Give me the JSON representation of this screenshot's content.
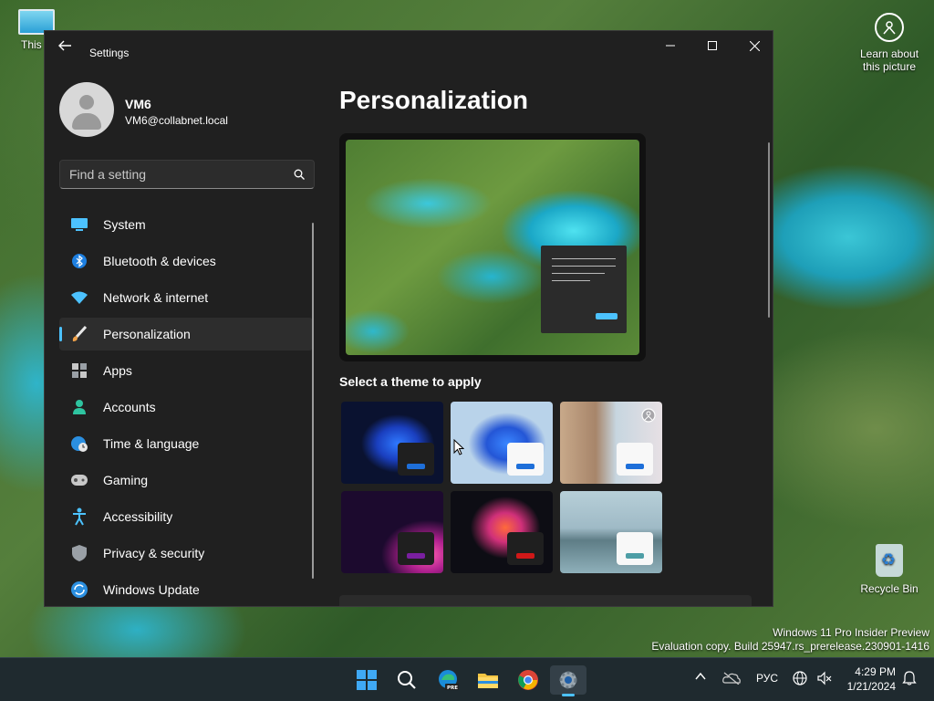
{
  "desktop": {
    "this_pc_label": "This P",
    "learn_label": "Learn about this picture",
    "recycle_label": "Recycle Bin",
    "watermark_line1": "Windows 11 Pro Insider Preview",
    "watermark_line2": "Evaluation copy. Build 25947.rs_prerelease.230901-1416"
  },
  "window": {
    "title": "Settings"
  },
  "user": {
    "name": "VM6",
    "email": "VM6@collabnet.local"
  },
  "search": {
    "placeholder": "Find a setting"
  },
  "sidebar": {
    "items": [
      {
        "label": "System",
        "icon": "monitor-icon",
        "active": false
      },
      {
        "label": "Bluetooth & devices",
        "icon": "bluetooth-icon",
        "active": false
      },
      {
        "label": "Network & internet",
        "icon": "wifi-icon",
        "active": false
      },
      {
        "label": "Personalization",
        "icon": "paintbrush-icon",
        "active": true
      },
      {
        "label": "Apps",
        "icon": "apps-icon",
        "active": false
      },
      {
        "label": "Accounts",
        "icon": "person-icon",
        "active": false
      },
      {
        "label": "Time & language",
        "icon": "globe-clock-icon",
        "active": false
      },
      {
        "label": "Gaming",
        "icon": "gamepad-icon",
        "active": false
      },
      {
        "label": "Accessibility",
        "icon": "accessibility-icon",
        "active": false
      },
      {
        "label": "Privacy & security",
        "icon": "shield-icon",
        "active": false
      },
      {
        "label": "Windows Update",
        "icon": "update-icon",
        "active": false
      }
    ]
  },
  "main": {
    "title": "Personalization",
    "theme_heading": "Select a theme to apply",
    "themes": [
      {
        "name": "windows-dark",
        "accent": "#1e6fd9"
      },
      {
        "name": "windows-light",
        "accent": "#1e6fd9"
      },
      {
        "name": "windows-spotlight",
        "accent": "#1e6fd9"
      },
      {
        "name": "glow",
        "accent": "#7a1fa0"
      },
      {
        "name": "captured-motion",
        "accent": "#d01818"
      },
      {
        "name": "flow",
        "accent": "#4e9ea6"
      }
    ]
  },
  "taskbar": {
    "apps": [
      "start-icon",
      "search-icon",
      "edge-pre-icon",
      "file-explorer-icon",
      "chrome-icon",
      "settings-icon"
    ],
    "language": "РУС",
    "time": "4:29 PM",
    "date": "1/21/2024"
  },
  "colors": {
    "accent": "#4cc2ff",
    "window_bg": "#202020",
    "taskbar_bg": "#1f2a2f"
  }
}
